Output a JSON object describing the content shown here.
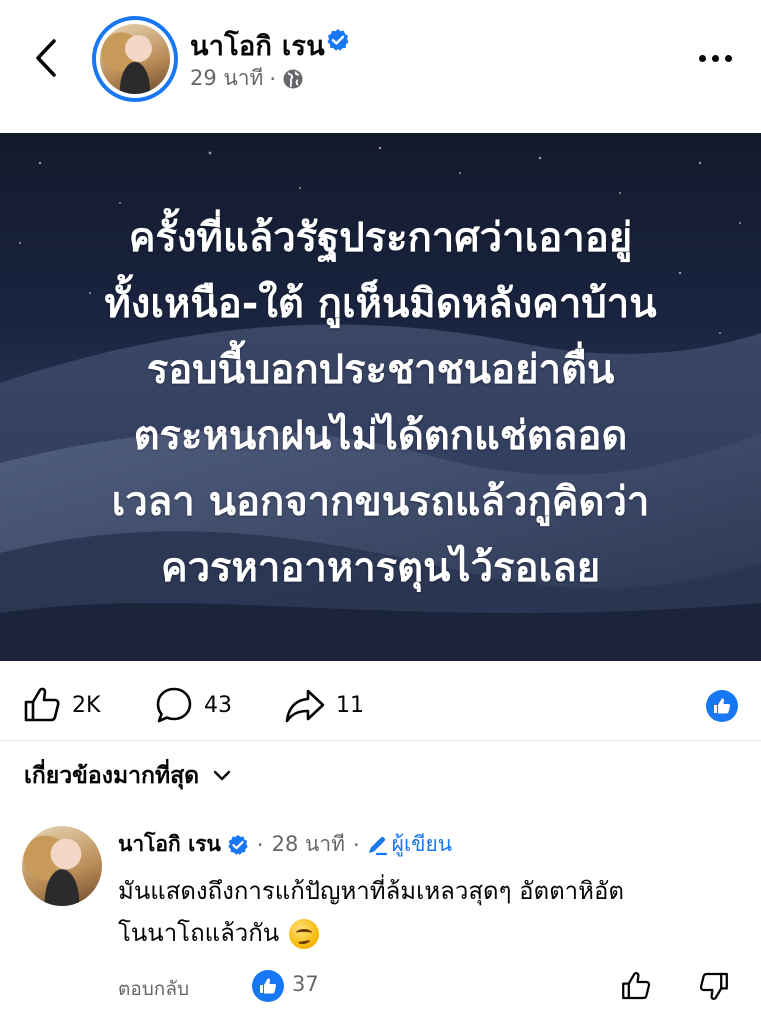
{
  "header": {
    "author_name": "นาโอกิ เรน",
    "post_time": "29 นาที",
    "separator": "·"
  },
  "post": {
    "text_lines": [
      "ครั้งที่แล้วรัฐประกาศว่าเอาอยู่",
      "ทั้งเหนือ-ใต้ กูเห็นมิดหลังคาบ้าน",
      "รอบนี้บอกประชาชนอย่าตื่น",
      "ตระหนกฝนไม่ได้ตกแช่ตลอด",
      "เวลา นอกจากขนรถแล้วกูคิดว่า",
      "ควรหาอาหารตุนไว้รอเลย"
    ]
  },
  "actions": {
    "likes": "2K",
    "comments": "43",
    "shares": "11"
  },
  "sort": {
    "label": "เกี่ยวข้องมากที่สุด"
  },
  "comment": {
    "author": "นาโอกิ เรน",
    "time": "28 นาที",
    "separator": "·",
    "author_tag": "ผู้เขียน",
    "body_lines": [
      "มันแสดงถึงการแก้ปัญหาที่ล้มเหลวสุดๆ อัตตาหิอัต",
      "โนนาโถแล้วกัน"
    ],
    "reply_label": "ตอบกลับ",
    "reaction_count": "37"
  },
  "colors": {
    "accent": "#1877f2",
    "muted_text": "#65676b",
    "text": "#050505"
  }
}
